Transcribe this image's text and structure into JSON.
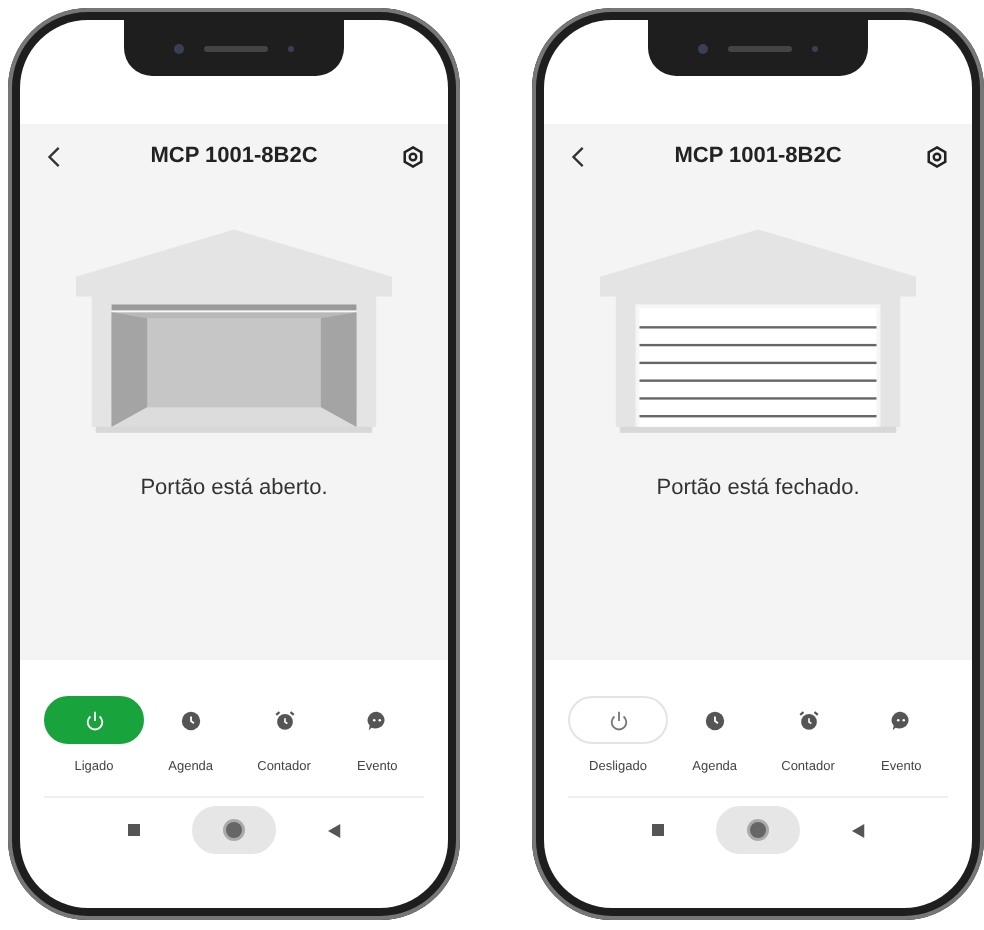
{
  "phones": [
    {
      "title": "MCP 1001-8B2C",
      "gate_open": true,
      "status": "Portão está aberto.",
      "power": {
        "label": "Ligado",
        "on": true
      },
      "tabs": [
        {
          "kind": "schedule",
          "label": "Agenda"
        },
        {
          "kind": "timer",
          "label": "Contador"
        },
        {
          "kind": "event",
          "label": "Evento"
        }
      ]
    },
    {
      "title": "MCP 1001-8B2C",
      "gate_open": false,
      "status": "Portão está fechado.",
      "power": {
        "label": "Desligado",
        "on": false
      },
      "tabs": [
        {
          "kind": "schedule",
          "label": "Agenda"
        },
        {
          "kind": "timer",
          "label": "Contador"
        },
        {
          "kind": "event",
          "label": "Evento"
        }
      ]
    }
  ]
}
